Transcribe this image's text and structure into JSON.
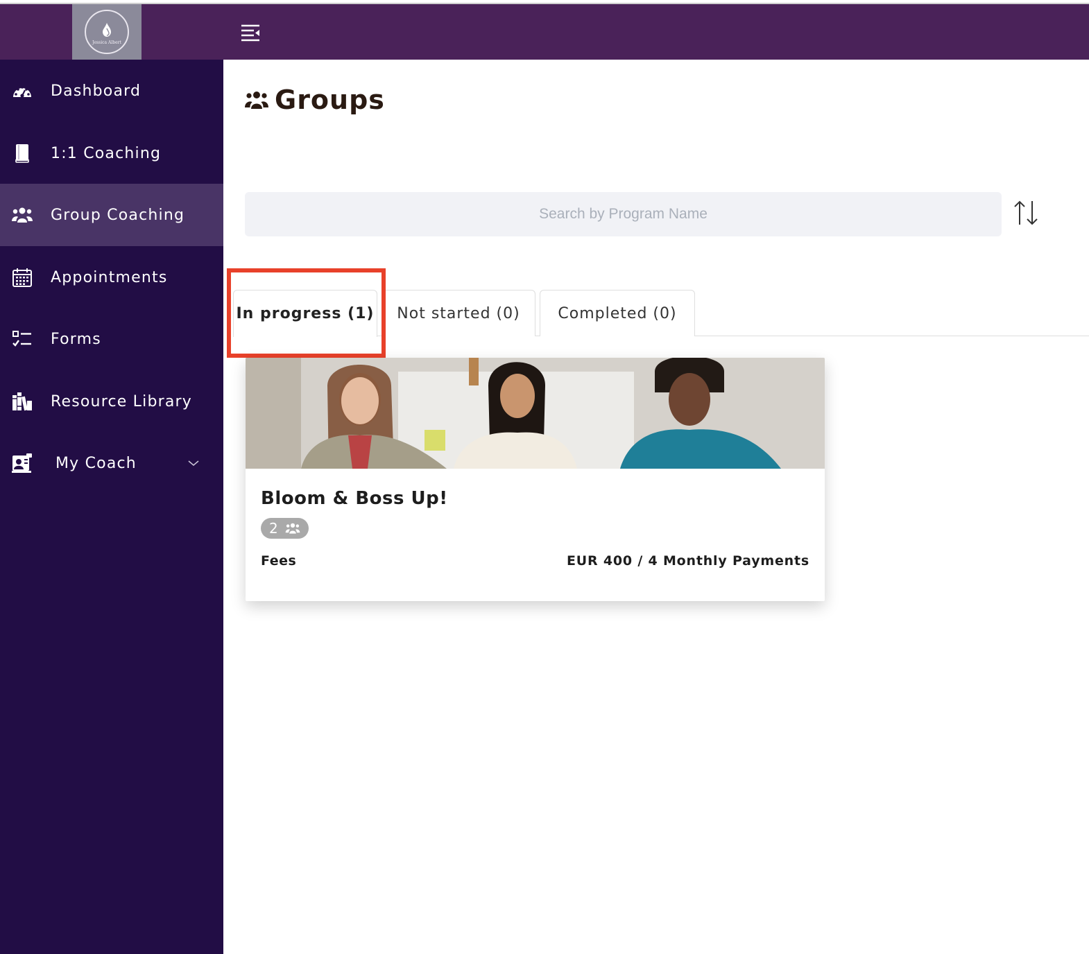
{
  "brand": {
    "logo_text": "Jessica Albert"
  },
  "sidebar": {
    "items": [
      {
        "label": "Dashboard",
        "icon": "dashboard-gauge-icon"
      },
      {
        "label": "1:1 Coaching",
        "icon": "book-icon"
      },
      {
        "label": "Group Coaching",
        "icon": "users-icon",
        "active": true
      },
      {
        "label": "Appointments",
        "icon": "calendar-icon"
      },
      {
        "label": "Forms",
        "icon": "checklist-icon"
      },
      {
        "label": "Resource Library",
        "icon": "library-icon"
      },
      {
        "label": "My Coach",
        "icon": "coach-profile-icon"
      }
    ]
  },
  "main": {
    "title": "Groups",
    "search": {
      "placeholder": "Search by Program Name",
      "value": ""
    },
    "tabs": [
      {
        "label": "In progress (1)",
        "active": true
      },
      {
        "label": "Not started (0)"
      },
      {
        "label": "Completed (0)"
      }
    ],
    "card": {
      "title": "Bloom & Boss Up!",
      "members": "2",
      "fees_label": "Fees",
      "fees_value": "EUR 400 / 4 Monthly Payments"
    }
  },
  "colors": {
    "topbar": "#4a2259",
    "sidebar": "#220d45",
    "sidebar_active": "#493466",
    "highlight": "#e8412a"
  }
}
